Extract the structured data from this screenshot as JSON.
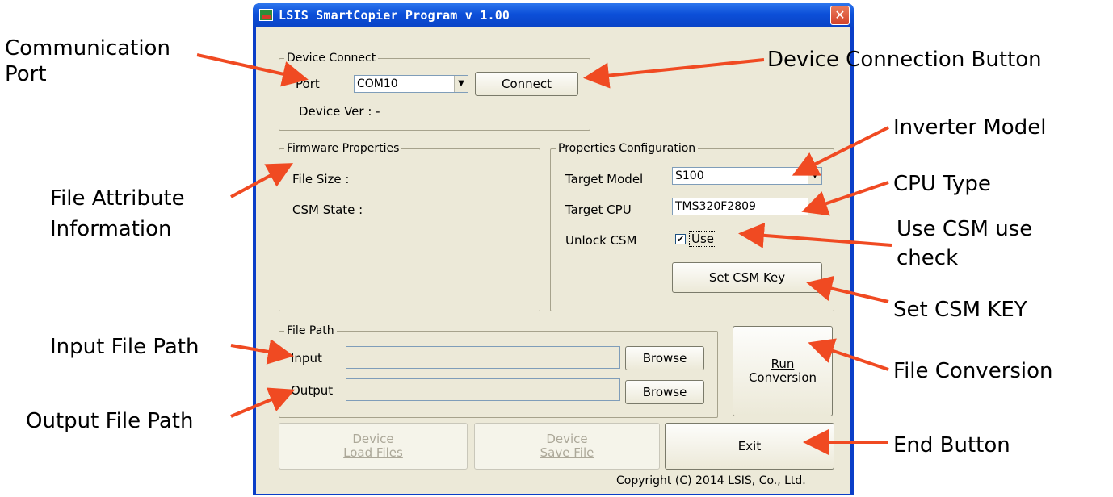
{
  "window": {
    "title": "LSIS SmartCopier Program v 1.00",
    "close_glyph": "✕"
  },
  "device_connect": {
    "group_label": "Device Connect",
    "port_label": "Port",
    "port_value": "COM10",
    "connect_button": "Connect",
    "device_ver_label": "Device Ver :  -"
  },
  "firmware_properties": {
    "group_label": "Firmware Properties",
    "file_size_label": "File Size :",
    "csm_state_label": "CSM State :"
  },
  "properties_configuration": {
    "group_label": "Properties Configuration",
    "target_model_label": "Target Model",
    "target_model_value": "S100",
    "target_cpu_label": "Target CPU",
    "target_cpu_value": "TMS320F2809",
    "unlock_csm_label": "Unlock CSM",
    "use_checkbox_label": "Use",
    "use_checked": true,
    "set_csm_key_button": "Set CSM Key"
  },
  "file_path": {
    "group_label": "File Path",
    "input_label": "Input",
    "output_label": "Output",
    "input_value": "",
    "output_value": "",
    "browse_input": "Browse",
    "browse_output": "Browse"
  },
  "buttons": {
    "run_conversion_line1": "Run",
    "run_conversion_line2": "Conversion",
    "device_load_line1": "Device",
    "device_load_line2": "Load Files",
    "device_save_line1": "Device",
    "device_save_line2": "Save File",
    "exit": "Exit"
  },
  "copyright": "Copyright (C) 2014 LSIS, Co., Ltd.",
  "annotations": {
    "communication_port_line1": "Communication",
    "communication_port_line2": "Port",
    "device_connection_button": "Device Connection Button",
    "file_attribute_line1": "File Attribute",
    "file_attribute_line2": "Information",
    "inverter_model": "Inverter Model",
    "cpu_type": "CPU Type",
    "use_csm_line1": "Use CSM use",
    "use_csm_line2": "check",
    "set_csm_key": "Set CSM KEY",
    "input_file_path": "Input File Path",
    "file_conversion": "File Conversion",
    "output_file_path": "Output File Path",
    "end_button": "End Button"
  },
  "colors": {
    "arrow": "#f04a22",
    "window_frame": "#0a3ec8",
    "client_background": "#ece9d8"
  }
}
